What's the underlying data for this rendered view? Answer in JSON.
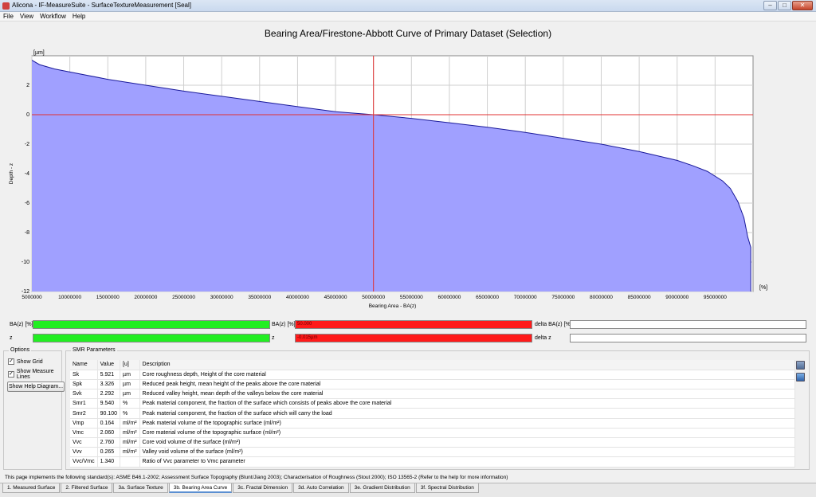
{
  "window": {
    "title": "Alicona - IF-MeasureSuite - SurfaceTextureMeasurement  [Seal]"
  },
  "menu": [
    "File",
    "View",
    "Workflow",
    "Help"
  ],
  "chart_title": "Bearing Area/Firestone-Abbott Curve of Primary Dataset (Selection)",
  "chart_data": {
    "type": "area",
    "title": "Bearing Area/Firestone-Abbott Curve of Primary Dataset (Selection)",
    "xlabel": "Bearing Area - BA(z)",
    "ylabel": "Depth - z",
    "x_unit": "[%]",
    "y_unit": "[µm]",
    "xlim": [
      5000000,
      100000000
    ],
    "ylim": [
      -12,
      4
    ],
    "x_ticks": [
      "5000000",
      "10000000",
      "15000000",
      "20000000",
      "25000000",
      "30000000",
      "35000000",
      "40000000",
      "45000000",
      "50000000",
      "55000000",
      "60000000",
      "65000000",
      "70000000",
      "75000000",
      "80000000",
      "85000000",
      "90000000",
      "95000000"
    ],
    "y_ticks": [
      "2",
      "0",
      "-2",
      "-4",
      "-6",
      "-8",
      "-10",
      "-12"
    ],
    "grid": true,
    "measure_line_x": 50000000,
    "measure_line_y": 0,
    "fill_color": "#a0a0ff",
    "line_color": "#1a1a9a",
    "x": [
      5000000,
      6000000,
      8000000,
      10000000,
      15000000,
      20000000,
      25000000,
      30000000,
      35000000,
      40000000,
      45000000,
      50000000,
      55000000,
      60000000,
      65000000,
      70000000,
      75000000,
      80000000,
      85000000,
      90000000,
      92000000,
      94000000,
      96000000,
      97000000,
      98000000,
      98800000,
      99300000,
      99700000
    ],
    "y": [
      3.7,
      3.4,
      3.1,
      2.9,
      2.4,
      2.0,
      1.6,
      1.25,
      0.9,
      0.55,
      0.2,
      0.0,
      -0.25,
      -0.55,
      -0.85,
      -1.2,
      -1.6,
      -2.0,
      -2.5,
      -3.1,
      -3.45,
      -3.85,
      -4.5,
      -5.0,
      -5.9,
      -7.0,
      -8.3,
      -9.0
    ]
  },
  "bars": {
    "ba_label": "BA(z) [%]",
    "z_label": "z",
    "ba2_label": "BA(z) [%]",
    "z2_label": "z",
    "ba2_value": "50.000",
    "z2_value": "-0.015µm",
    "delta_ba_label": "delta BA(z) [%]",
    "delta_z_label": "delta z",
    "colors": {
      "green": "#22ee22",
      "red": "#ff1a1a"
    }
  },
  "options": {
    "title": "Options",
    "show_grid": "Show Grid",
    "show_measure_lines": "Show Measure Lines",
    "help_button": "Show Help Diagram..."
  },
  "smr": {
    "title": "SMR Parameters",
    "headers": [
      "Name",
      "Value",
      "[u]",
      "Description"
    ],
    "rows": [
      [
        "Sk",
        "5.921",
        "µm",
        "Core roughness depth, Height of the core material"
      ],
      [
        "Spk",
        "3.326",
        "µm",
        "Reduced peak height, mean height of the peaks above the core material"
      ],
      [
        "Svk",
        "2.292",
        "µm",
        "Reduced valley height, mean depth of the valleys below the core material"
      ],
      [
        "Smr1",
        "9.540",
        "%",
        "Peak material component, the fraction of the surface which consists of peaks above the core material"
      ],
      [
        "Smr2",
        "90.100",
        "%",
        "Peak material component, the fraction of the surface which will carry the load"
      ],
      [
        "Vmp",
        "0.164",
        "ml/m²",
        "Peak material volume of the topographic surface (ml/m²)"
      ],
      [
        "Vmc",
        "2.060",
        "ml/m²",
        "Core material volume of the topographic surface (ml/m²)"
      ],
      [
        "Vvc",
        "2.760",
        "ml/m²",
        "Core void volume of the surface (ml/m²)"
      ],
      [
        "Vvv",
        "0.265",
        "ml/m²",
        "Valley void volume of the surface (ml/m²)"
      ],
      [
        "Vvc/Vmc",
        "1.340",
        "",
        "Ratio of Vvc parameter to Vmc parameter"
      ]
    ]
  },
  "footer_note": "This page implements the following standard(s): ASME B46.1-2002; Assessment Surface Topography (Blunt/Jiang 2003); Characterisation of Roughness (Stout 2000); ISO 13565-2 (Refer to the help for more information)",
  "tabs": [
    "1. Measured Surface",
    "2. Filtered Surface",
    "3a. Surface Texture",
    "3b. Bearing Area Curve",
    "3c. Fractal Dimension",
    "3d. Auto Correlation",
    "3e. Gradient Distribution",
    "3f. Spectral Distribution"
  ],
  "active_tab": 3
}
